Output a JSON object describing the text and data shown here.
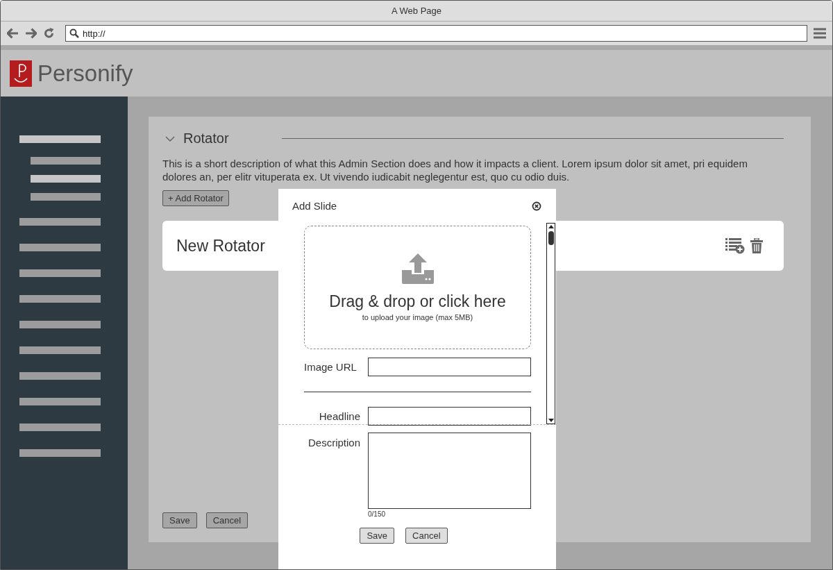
{
  "window": {
    "title": "A Web Page"
  },
  "address_bar": {
    "value": "http://"
  },
  "header": {
    "logo_text": "Personify"
  },
  "sidebar": {
    "items": [
      {
        "selected": true,
        "children": [
          {
            "selected": false
          },
          {
            "selected": true
          },
          {
            "selected": false
          }
        ]
      },
      {
        "selected": false
      },
      {
        "selected": false
      },
      {
        "selected": false
      },
      {
        "selected": false
      },
      {
        "selected": false
      },
      {
        "selected": false
      },
      {
        "selected": false
      },
      {
        "selected": false
      },
      {
        "selected": false
      },
      {
        "selected": false
      }
    ]
  },
  "section": {
    "title": "Rotator",
    "expanded": true,
    "description": "This is a short description of what this Admin Section does and how it impacts a client. Lorem ipsum dolor sit amet, pri equidem dolores an, per elitr vituperata ex. Ut vivendo iudicabit neglegentur est, quo cu odio duis.",
    "add_button": "+ Add Rotator",
    "rotators": [
      {
        "title": "New Rotator"
      }
    ],
    "buttons": [
      "Save",
      "Cancel"
    ]
  },
  "modal": {
    "title": "Add Slide",
    "dropzone": {
      "title": "Drag & drop or click here",
      "subtitle": "to upload your image (max 5MB)"
    },
    "fields": [
      {
        "kind": "input",
        "label": "Image URL"
      },
      {
        "kind": "divider"
      },
      {
        "kind": "input",
        "label": "Headline"
      },
      {
        "kind": "textarea",
        "label": "Description",
        "counter": "0/150"
      }
    ],
    "buttons": [
      "Save",
      "Cancel"
    ]
  }
}
